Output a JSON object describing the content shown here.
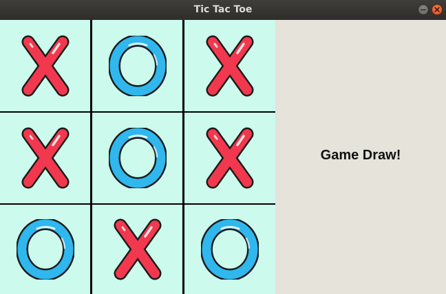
{
  "window": {
    "title": "Tic Tac Toe"
  },
  "board": {
    "cells": [
      [
        "X",
        "O",
        "X"
      ],
      [
        "X",
        "O",
        "X"
      ],
      [
        "O",
        "X",
        "O"
      ]
    ],
    "colors": {
      "background": "#ccfaed",
      "grid": "#000000",
      "x_mark": "#f2384e",
      "o_mark": "#2fb7ee",
      "outline": "#1b1b1b"
    }
  },
  "panel": {
    "status": "Game Draw!",
    "background": "#e5e3da"
  }
}
